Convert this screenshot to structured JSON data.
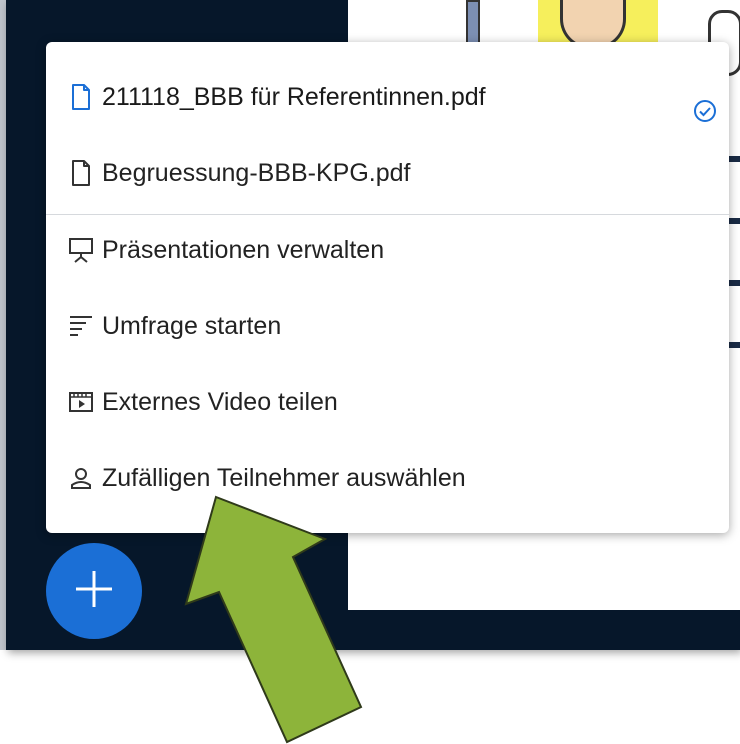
{
  "menu": {
    "presentations": [
      {
        "label": "211118_BBB für Referentinnen.pdf",
        "icon": "file-icon",
        "selected": true
      },
      {
        "label": "Begruessung-BBB-KPG.pdf",
        "icon": "file-icon",
        "selected": false
      }
    ],
    "actions": [
      {
        "label": "Präsentationen verwalten",
        "icon": "presentation-icon"
      },
      {
        "label": "Umfrage starten",
        "icon": "poll-icon"
      },
      {
        "label": "Externes Video teilen",
        "icon": "video-icon"
      },
      {
        "label": "Zufälligen Teilnehmer auswählen",
        "icon": "user-icon"
      }
    ]
  },
  "fab": {
    "icon": "plus-icon"
  },
  "colors": {
    "accent": "#1b6fd6",
    "background": "#06172a",
    "arrow": "#8db43a"
  }
}
